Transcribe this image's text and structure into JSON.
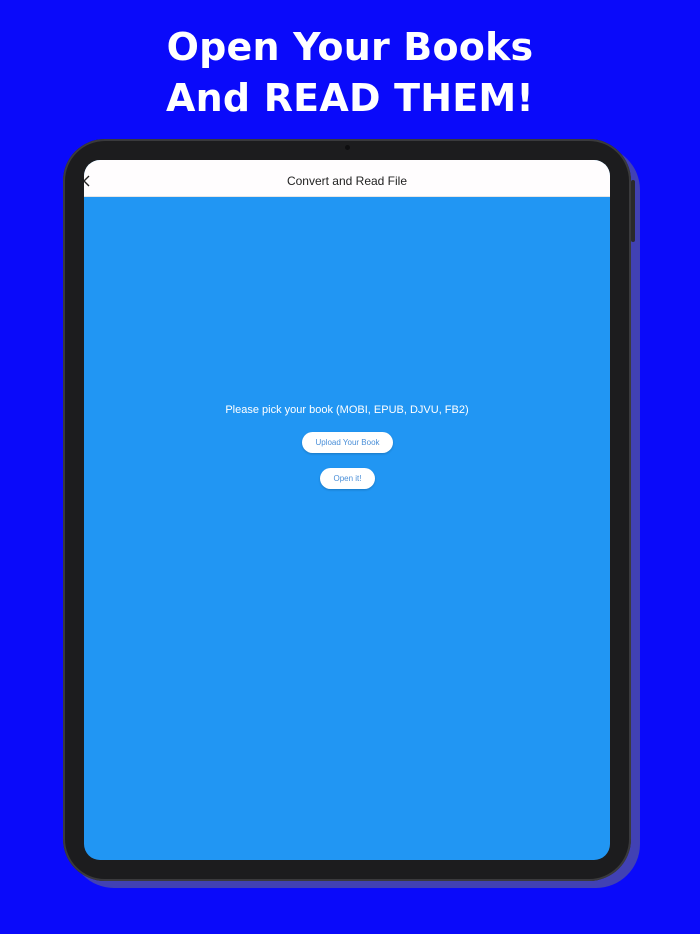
{
  "promo": {
    "headline_line1": "Open Your Books",
    "headline_line2": "And READ THEM!"
  },
  "nav": {
    "title": "Convert and Read File",
    "back_icon": "chevron-left-icon"
  },
  "main": {
    "prompt": "Please pick your book (MOBI, EPUB, DJVU, FB2)",
    "upload_label": "Upload Your Book",
    "open_label": "Open it!"
  },
  "colors": {
    "background": "#0a0afa",
    "screen": "#2196f3",
    "button_text": "#4a8fd8"
  }
}
